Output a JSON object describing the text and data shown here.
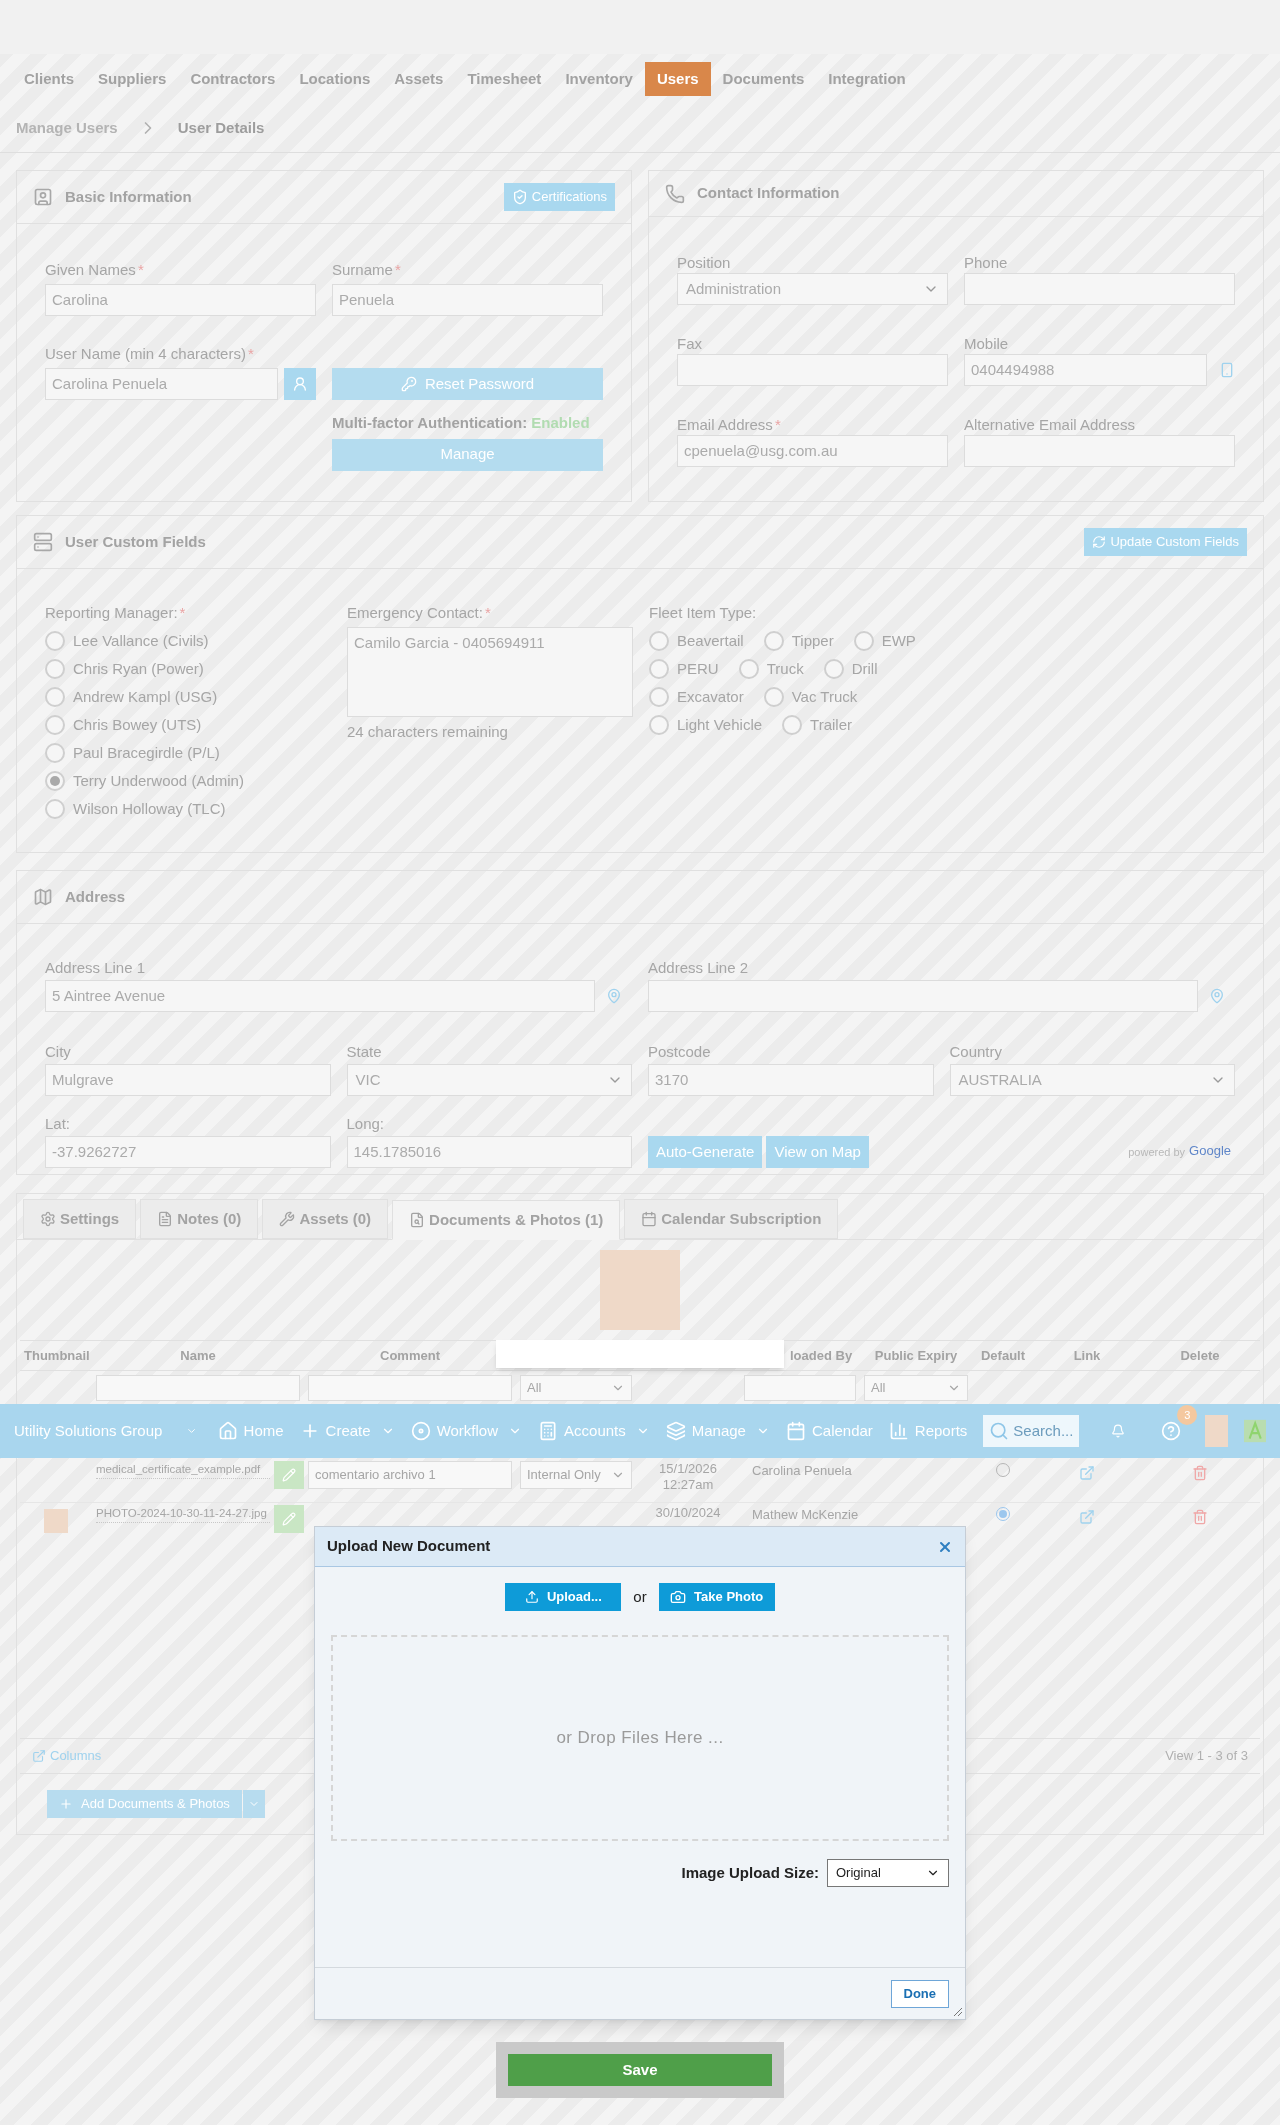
{
  "top_nav": {
    "items": [
      {
        "label": "Clients",
        "selected": false
      },
      {
        "label": "Suppliers",
        "selected": false
      },
      {
        "label": "Contractors",
        "selected": false
      },
      {
        "label": "Locations",
        "selected": false
      },
      {
        "label": "Assets",
        "selected": false
      },
      {
        "label": "Timesheet",
        "selected": false
      },
      {
        "label": "Inventory",
        "selected": false
      },
      {
        "label": "Users",
        "selected": true
      },
      {
        "label": "Documents",
        "selected": false
      },
      {
        "label": "Integration",
        "selected": false
      }
    ]
  },
  "breadcrumb": [
    "Manage Users",
    "User Details"
  ],
  "basic_information": {
    "title": "Basic Information",
    "certifications_button": "Certifications",
    "given_names": {
      "label": "Given Names",
      "required_mark": "*",
      "value": "Carolina"
    },
    "surname": {
      "label": "Surname",
      "required_mark": "*",
      "value": "Penuela"
    },
    "user_name": {
      "label": "User Name (min 4 characters)",
      "required_mark": "*",
      "value": "Carolina Penuela"
    },
    "reset_password_button": "Reset Password",
    "mfa": {
      "label": "Multi-factor Authentication:",
      "status": "Enabled"
    },
    "manage_button": "Manage"
  },
  "contact_information": {
    "title": "Contact Information",
    "fields": [
      {
        "kind": "select",
        "label": "Position",
        "value": "Administration"
      },
      {
        "kind": "input",
        "label": "Phone"
      },
      {
        "kind": "input",
        "label": "Fax"
      },
      {
        "kind": "phone",
        "label": "Mobile",
        "value": "0404494988"
      },
      {
        "kind": "input",
        "label": "Email Address",
        "required_mark": "*",
        "value": "cpenuela@usg.com.au"
      },
      {
        "kind": "input",
        "label": "Alternative Email Address"
      }
    ]
  },
  "user_custom_fields": {
    "title": "User Custom Fields",
    "update_button": "Update Custom Fields",
    "reporting_manager": {
      "label": "Reporting Manager:",
      "required_mark": "*",
      "options": [
        {
          "label": "Lee Vallance (Civils)",
          "selected": false
        },
        {
          "label": "Chris Ryan (Power)",
          "selected": false
        },
        {
          "label": "Andrew Kampl (USG)",
          "selected": false
        },
        {
          "label": "Chris Bowey (UTS)",
          "selected": false
        },
        {
          "label": "Paul Bracegirdle (P/L)",
          "selected": false
        },
        {
          "label": "Terry Underwood (Admin)",
          "selected": true
        },
        {
          "label": "Wilson Holloway (TLC)",
          "selected": false
        }
      ]
    },
    "emergency_contact": {
      "label": "Emergency Contact:",
      "required_mark": "*",
      "value": "Camilo Garcia - 0405694911",
      "hint": "24 characters remaining"
    },
    "fleet_item_type": {
      "label": "Fleet Item Type:",
      "rows": [
        {
          "options": [
            {
              "label": "Beavertail",
              "selected": false
            },
            {
              "label": "Tipper",
              "selected": false
            },
            {
              "label": "EWP",
              "selected": false
            }
          ]
        },
        {
          "options": [
            {
              "label": "PERU",
              "selected": false
            },
            {
              "label": "Truck",
              "selected": false
            },
            {
              "label": "Drill",
              "selected": false
            }
          ]
        },
        {
          "options": [
            {
              "label": "Excavator",
              "selected": false
            },
            {
              "label": "Vac Truck",
              "selected": false
            }
          ]
        },
        {
          "options": [
            {
              "label": "Light Vehicle",
              "selected": false
            },
            {
              "label": "Trailer",
              "selected": false
            }
          ]
        }
      ]
    }
  },
  "address": {
    "title": "Address",
    "address_line_1": {
      "label": "Address Line 1",
      "value": "5 Aintree Avenue"
    },
    "address_line_2": {
      "label": "Address Line 2"
    },
    "city": {
      "label": "City",
      "value": "Mulgrave"
    },
    "state": {
      "label": "State",
      "value": "VIC"
    },
    "postcode": {
      "label": "Postcode",
      "value": "3170"
    },
    "country": {
      "label": "Country",
      "value": "AUSTRALIA"
    },
    "lat": {
      "label": "Lat:",
      "value": "-37.9262727"
    },
    "long": {
      "label": "Long:",
      "value": "145.1785016"
    },
    "buttons": [
      "Auto-Generate",
      "View on Map"
    ],
    "attribution": {
      "text": "powered by",
      "brand": "Google"
    }
  },
  "documents": {
    "tabs": [
      {
        "label": "Settings",
        "kind": "settings",
        "selected": false
      },
      {
        "label": "Notes (0)",
        "kind": "notes",
        "selected": false
      },
      {
        "label": "Assets (0)",
        "kind": "assets",
        "selected": false
      },
      {
        "label": "Documents & Photos (1)",
        "kind": "documents",
        "selected": true
      },
      {
        "label": "Calendar Subscription",
        "kind": "calendar",
        "selected": false
      }
    ],
    "columns": [
      {
        "kind": "text",
        "label": "Thumbnail"
      },
      {
        "kind": "text",
        "label": "Name"
      },
      {
        "kind": "text",
        "label": "Comment"
      },
      {
        "kind": "covered"
      },
      {
        "kind": "covered"
      },
      {
        "kind": "text",
        "label": "loaded By"
      },
      {
        "kind": "text",
        "label": "Public Expiry"
      },
      {
        "kind": "text",
        "label": "Default"
      },
      {
        "kind": "text",
        "label": "Link"
      },
      {
        "kind": "text",
        "label": "Delete"
      }
    ],
    "filters": [
      {
        "kind": "none"
      },
      {
        "kind": "input"
      },
      {
        "kind": "input"
      },
      {
        "kind": "select",
        "value": "All"
      },
      {
        "kind": "none"
      },
      {
        "kind": "input"
      },
      {
        "kind": "select",
        "value": "All"
      },
      {
        "kind": "none"
      },
      {
        "kind": "none"
      },
      {
        "kind": "none"
      }
    ],
    "rows": [
      {
        "thumbnail": false,
        "name": "medical_certificate_example.pdf",
        "comment": "comentario archivo 1",
        "visibility": "Internal Only",
        "date": "15/1/2026",
        "time": "12:27am",
        "uploaded_by": "Carolina Penuela",
        "default_selected": false
      },
      {
        "thumbnail": true,
        "name": "PHOTO-2024-10-30-11-24-27.jpg",
        "date": "30/10/2024",
        "uploaded_by": "Mathew McKenzie",
        "default_selected": true
      }
    ],
    "columns_link": "Columns",
    "pager": "View 1 - 3 of 3",
    "add_button": "Add Documents & Photos"
  },
  "header_bar": {
    "org": "Utility Solutions Group",
    "items": [
      {
        "label": "Home",
        "kind": "home",
        "dropdown": false
      },
      {
        "label": "Create",
        "kind": "create",
        "dropdown": true
      },
      {
        "label": "Workflow",
        "kind": "workflow",
        "dropdown": true
      },
      {
        "label": "Accounts",
        "kind": "accounts",
        "dropdown": true
      },
      {
        "label": "Manage",
        "kind": "manage",
        "dropdown": true
      },
      {
        "label": "Calendar",
        "kind": "calendar",
        "dropdown": false
      },
      {
        "label": "Reports",
        "kind": "reports",
        "dropdown": false
      }
    ],
    "search_placeholder": "Search...",
    "notification_count": "3"
  },
  "upload_dialog": {
    "title": "Upload New Document",
    "upload_button": "Upload...",
    "or": "or",
    "take_photo_button": "Take Photo",
    "drop_text": "or Drop Files Here ...",
    "size_label": "Image Upload Size:",
    "size_value": "Original",
    "done_button": "Done"
  },
  "save_button": "Save"
}
